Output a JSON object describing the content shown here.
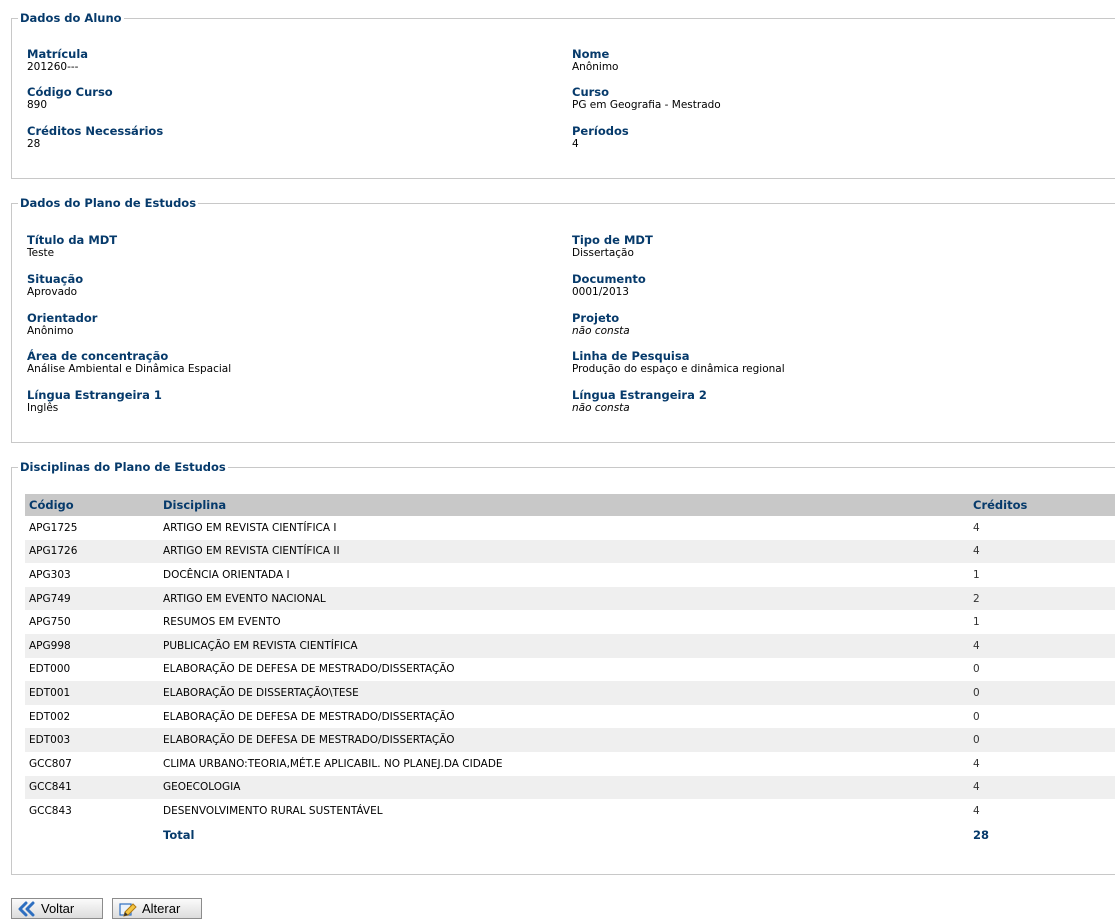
{
  "aluno": {
    "legend": "Dados do Aluno",
    "fields": [
      {
        "label": "Matrícula",
        "value": "201260---"
      },
      {
        "label": "Nome",
        "value": "Anônimo"
      },
      {
        "label": "Código Curso",
        "value": "890"
      },
      {
        "label": "Curso",
        "value": "PG em Geografia - Mestrado"
      },
      {
        "label": "Créditos Necessários",
        "value": "28"
      },
      {
        "label": "Períodos",
        "value": "4"
      }
    ]
  },
  "plano": {
    "legend": "Dados do Plano de Estudos",
    "fields": [
      {
        "label": "Título da MDT",
        "value": "Teste"
      },
      {
        "label": "Tipo de MDT",
        "value": "Dissertação"
      },
      {
        "label": "Situação",
        "value": "Aprovado"
      },
      {
        "label": "Documento",
        "value": "0001/2013"
      },
      {
        "label": "Orientador",
        "value": "Anônimo"
      },
      {
        "label": "Projeto",
        "value": "não consta"
      },
      {
        "label": "Área de concentração",
        "value": "Análise Ambiental e Dinâmica Espacial"
      },
      {
        "label": "Linha de Pesquisa",
        "value": "Produção do espaço e dinâmica regional"
      },
      {
        "label": "Língua Estrangeira 1",
        "value": "Inglês"
      },
      {
        "label": "Língua Estrangeira 2",
        "value": "não consta"
      }
    ]
  },
  "disciplinas": {
    "legend": "Disciplinas do Plano de Estudos",
    "headers": {
      "codigo": "Código",
      "disciplina": "Disciplina",
      "creditos": "Créditos"
    },
    "rows": [
      {
        "codigo": "APG1725",
        "disciplina": "ARTIGO EM REVISTA CIENTÍFICA I",
        "creditos": "4"
      },
      {
        "codigo": "APG1726",
        "disciplina": "ARTIGO EM REVISTA CIENTÍFICA II",
        "creditos": "4"
      },
      {
        "codigo": "APG303",
        "disciplina": "DOCÊNCIA ORIENTADA I",
        "creditos": "1"
      },
      {
        "codigo": "APG749",
        "disciplina": "ARTIGO EM EVENTO NACIONAL",
        "creditos": "2"
      },
      {
        "codigo": "APG750",
        "disciplina": "RESUMOS EM EVENTO",
        "creditos": "1"
      },
      {
        "codigo": "APG998",
        "disciplina": "PUBLICAÇÃO EM REVISTA CIENTÍFICA",
        "creditos": "4"
      },
      {
        "codigo": "EDT000",
        "disciplina": "ELABORAÇÃO DE DEFESA DE MESTRADO/DISSERTAÇÃO",
        "creditos": "0"
      },
      {
        "codigo": "EDT001",
        "disciplina": "ELABORAÇÃO DE DISSERTAÇÃO\\TESE",
        "creditos": "0"
      },
      {
        "codigo": "EDT002",
        "disciplina": "ELABORAÇÃO DE DEFESA DE MESTRADO/DISSERTAÇÃO",
        "creditos": "0"
      },
      {
        "codigo": "EDT003",
        "disciplina": "ELABORAÇÃO DE DEFESA DE MESTRADO/DISSERTAÇÃO",
        "creditos": "0"
      },
      {
        "codigo": "GCC807",
        "disciplina": "CLIMA URBANO:TEORIA,MÉT.E APLICABIL. NO PLANEJ.DA CIDADE",
        "creditos": "4"
      },
      {
        "codigo": "GCC841",
        "disciplina": "GEOECOLOGIA",
        "creditos": "4"
      },
      {
        "codigo": "GCC843",
        "disciplina": "DESENVOLVIMENTO RURAL SUSTENTÁVEL",
        "creditos": "4"
      }
    ],
    "total_label": "Total",
    "total_value": "28"
  },
  "buttons": {
    "voltar": "Voltar",
    "alterar": "Alterar"
  },
  "colors": {
    "label": "#063a6b",
    "header_bg": "#c8c8c8",
    "alt_row_bg": "#efefef"
  }
}
